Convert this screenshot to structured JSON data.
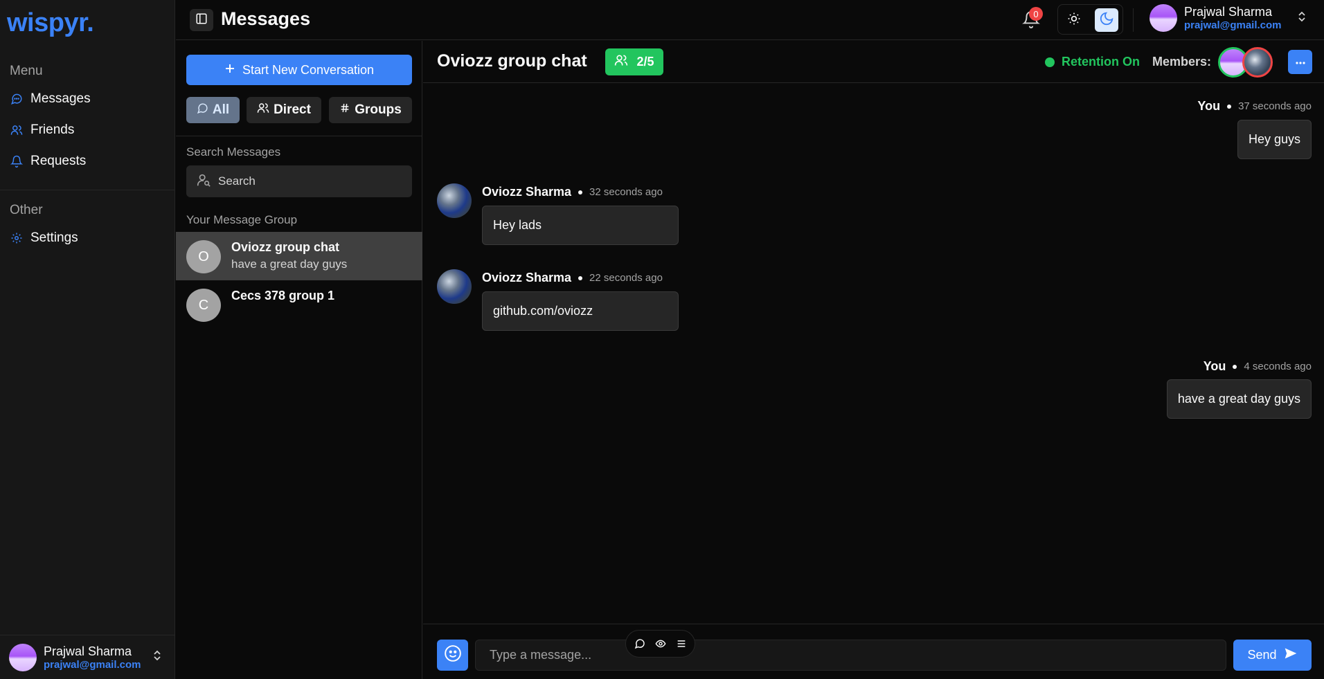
{
  "brand": {
    "logo": "wispyr.",
    "accent": "#3b82f6"
  },
  "nav": {
    "menu_label": "Menu",
    "items": [
      {
        "label": "Messages",
        "icon": "message-circle-icon"
      },
      {
        "label": "Friends",
        "icon": "users-icon"
      },
      {
        "label": "Requests",
        "icon": "bell-icon"
      }
    ],
    "other_label": "Other",
    "other_items": [
      {
        "label": "Settings",
        "icon": "gear-icon"
      }
    ],
    "user": {
      "name": "Prajwal Sharma",
      "email": "prajwal@gmail.com"
    }
  },
  "header": {
    "title": "Messages",
    "notification_count": "0",
    "user": {
      "name": "Prajwal Sharma",
      "email": "prajwal@gmail.com"
    }
  },
  "list": {
    "new_conversation": "Start New Conversation",
    "filters": [
      {
        "label": "All",
        "active": true
      },
      {
        "label": "Direct",
        "active": false
      },
      {
        "label": "Groups",
        "active": false
      }
    ],
    "search_label": "Search Messages",
    "search_placeholder": "Search",
    "groups_label": "Your Message Group",
    "conversations": [
      {
        "initial": "O",
        "title": "Oviozz group chat",
        "preview": "have a great day guys",
        "active": true
      },
      {
        "initial": "C",
        "title": "Cecs 378 group 1",
        "preview": "",
        "active": false
      }
    ]
  },
  "chat": {
    "title": "Oviozz group chat",
    "member_count": "2/5",
    "retention": "Retention On",
    "members_label": "Members:",
    "messages": [
      {
        "author": "You",
        "time": "37 seconds ago",
        "text": "Hey guys",
        "mine": true
      },
      {
        "author": "Oviozz Sharma",
        "time": "32 seconds ago",
        "text": "Hey lads",
        "mine": false
      },
      {
        "author": "Oviozz Sharma",
        "time": "22 seconds ago",
        "text": "github.com/oviozz",
        "mine": false
      },
      {
        "author": "You",
        "time": "4 seconds ago",
        "text": "have a great day guys",
        "mine": true
      }
    ],
    "input_placeholder": "Type a message...",
    "send_label": "Send"
  }
}
